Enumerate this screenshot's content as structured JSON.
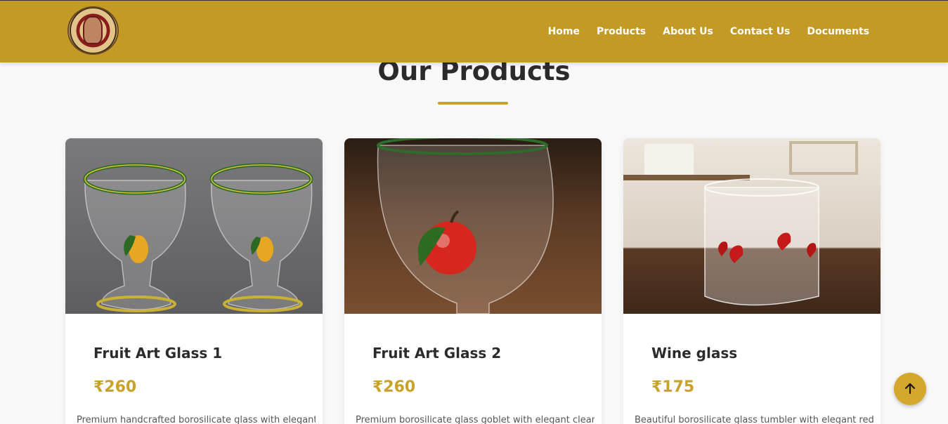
{
  "nav": {
    "items": [
      {
        "label": "Home"
      },
      {
        "label": "Products"
      },
      {
        "label": "About Us"
      },
      {
        "label": "Contact Us"
      },
      {
        "label": "Documents"
      }
    ]
  },
  "section": {
    "title": "Our Products"
  },
  "products": [
    {
      "name": "Fruit Art Glass 1",
      "price": "₹260",
      "description": "Premium handcrafted borosilicate glass with elegant",
      "image_icon": "goblet-pair-mango-icon"
    },
    {
      "name": "Fruit Art Glass 2",
      "price": "₹260",
      "description": "Premium borosilicate glass goblet with elegant clear",
      "image_icon": "goblet-apple-icon"
    },
    {
      "name": "Wine glass",
      "price": "₹175",
      "description": "Beautiful borosilicate glass tumbler with elegant red",
      "image_icon": "tumbler-hearts-icon"
    }
  ],
  "colors": {
    "navbar": "#c49a26",
    "accent": "#c9a227",
    "background": "#f9f9f9"
  },
  "icons": {
    "logo": "brand-logo-emblem",
    "scroll_top": "arrow-up-icon"
  }
}
